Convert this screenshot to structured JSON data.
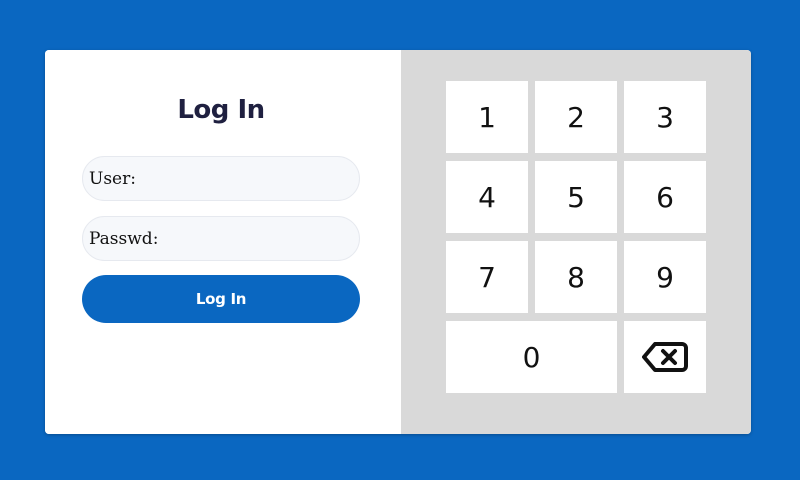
{
  "login": {
    "title": "Log In",
    "user_label": "User:",
    "user_value": "",
    "password_label": "Passwd:",
    "password_value": "",
    "button_label": "Log In"
  },
  "keypad": {
    "keys": [
      "1",
      "2",
      "3",
      "4",
      "5",
      "6",
      "7",
      "8",
      "9",
      "0"
    ],
    "backspace_icon": "backspace-icon"
  },
  "colors": {
    "primary": "#0a67c1",
    "keypad_background": "#d9d9d9",
    "key_background": "#ffffff",
    "title_text": "#1f2040"
  }
}
